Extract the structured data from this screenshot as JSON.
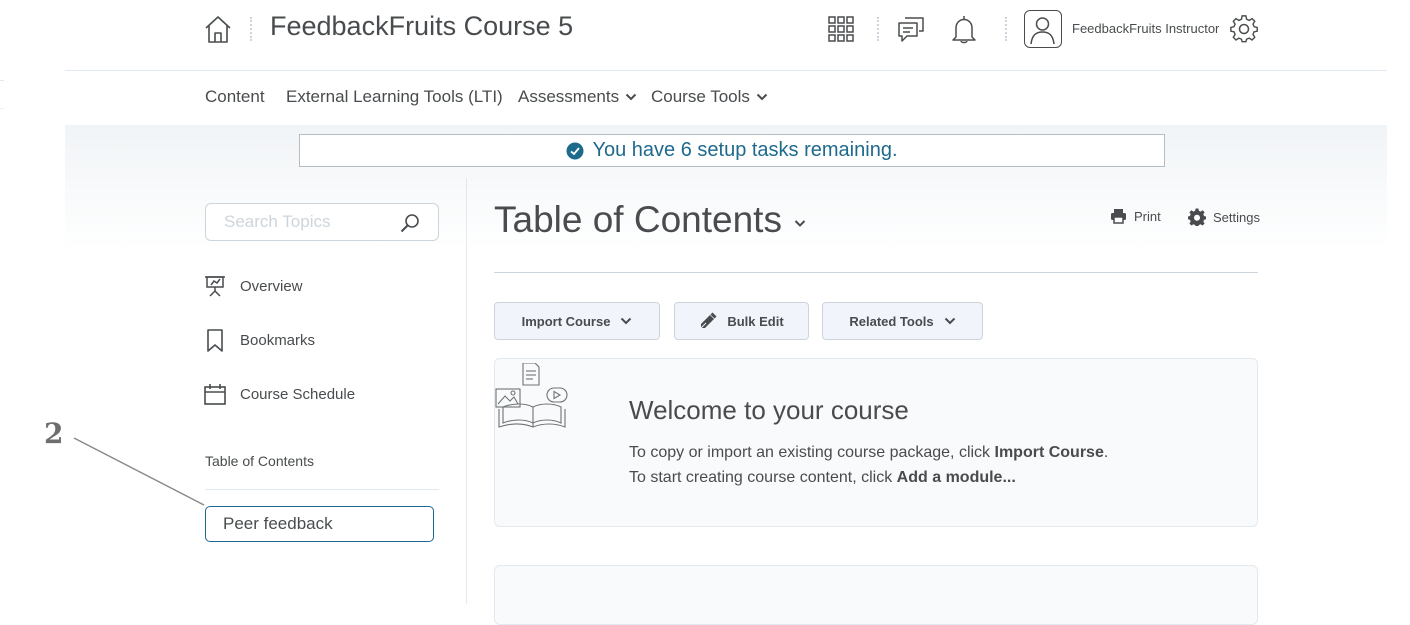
{
  "header": {
    "course_title": "FeedbackFruits Course 5",
    "user_name": "FeedbackFruits Instructor",
    "icons": [
      "home-icon",
      "apps-grid-icon",
      "chat-icon",
      "bell-icon",
      "user-avatar-icon",
      "gear-icon"
    ]
  },
  "nav": {
    "items": [
      {
        "label": "Content",
        "has_menu": false
      },
      {
        "label": "External Learning Tools (LTI)",
        "has_menu": false
      },
      {
        "label": "Assessments",
        "has_menu": true
      },
      {
        "label": "Course Tools",
        "has_menu": true
      }
    ]
  },
  "setup_banner": {
    "text": "You have 6 setup tasks remaining."
  },
  "sidebar": {
    "search_placeholder": "Search Topics",
    "items": [
      {
        "label": "Overview",
        "icon": "presentation-icon"
      },
      {
        "label": "Bookmarks",
        "icon": "bookmark-icon"
      },
      {
        "label": "Course Schedule",
        "icon": "calendar-icon"
      }
    ],
    "toc_label": "Table of Contents",
    "modules": [
      {
        "label": "Peer feedback"
      }
    ]
  },
  "annotation": {
    "number": "2"
  },
  "main": {
    "title": "Table of Contents",
    "print_label": "Print",
    "settings_label": "Settings",
    "buttons": {
      "import_course": "Import Course",
      "bulk_edit": "Bulk Edit",
      "related_tools": "Related Tools"
    },
    "welcome": {
      "title": "Welcome to your course",
      "line1_prefix": "To copy or import an existing course package, click ",
      "line1_bold": "Import Course",
      "line1_suffix": ".",
      "line2_prefix": "To start creating course content, click ",
      "line2_bold": "Add a module..."
    }
  },
  "colors": {
    "text": "#494c4e",
    "accent": "#1e6a8d",
    "border": "#cdd5dc",
    "button_bg": "#f1f5fb"
  }
}
